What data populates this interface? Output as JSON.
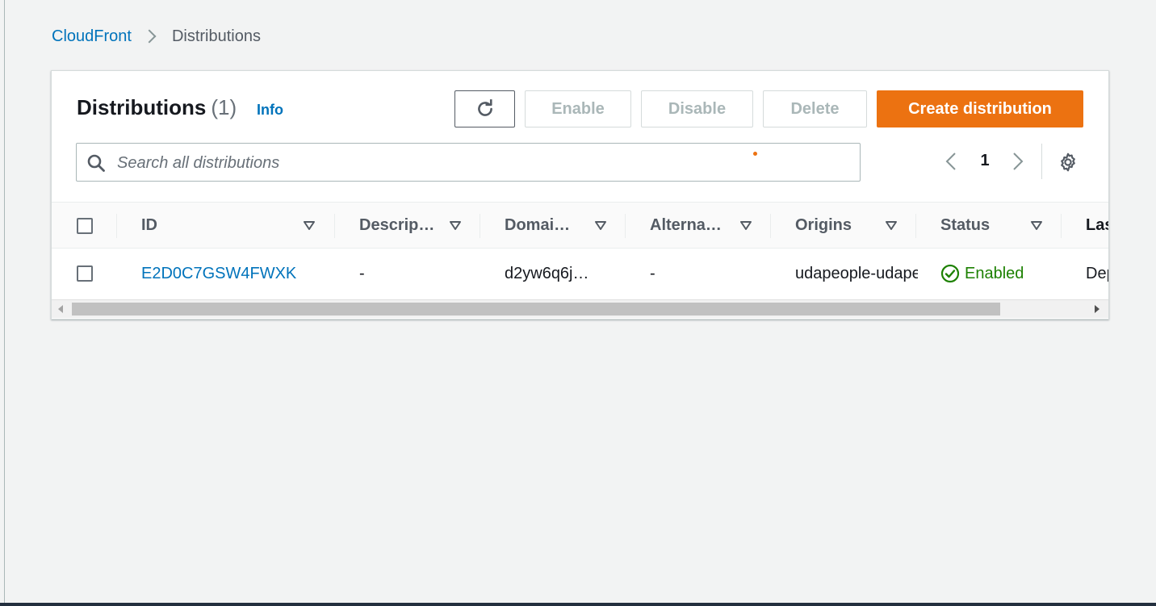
{
  "breadcrumb": {
    "parent": "CloudFront",
    "current": "Distributions"
  },
  "panel": {
    "title": "Distributions",
    "count": "(1)",
    "info": "Info"
  },
  "toolbar": {
    "refresh_icon": "refresh-icon",
    "enable": "Enable",
    "disable": "Disable",
    "delete": "Delete",
    "create": "Create distribution"
  },
  "search": {
    "placeholder": "Search all distributions",
    "value": ""
  },
  "pagination": {
    "page": "1"
  },
  "table": {
    "columns": [
      "ID",
      "Descrip…",
      "Domai…",
      "Alterna…",
      "Origins",
      "Status",
      "Las"
    ],
    "rows": [
      {
        "id": "E2D0C7GSW4FWXK",
        "description": "-",
        "domain": "d2yw6q6j…",
        "alternate": "-",
        "origins": "udapeople-udapeople",
        "status": "Enabled",
        "last": "Dep"
      }
    ]
  },
  "colors": {
    "accent": "#0073bb",
    "primary_button": "#ec7211",
    "status_enabled": "#1d8102"
  }
}
